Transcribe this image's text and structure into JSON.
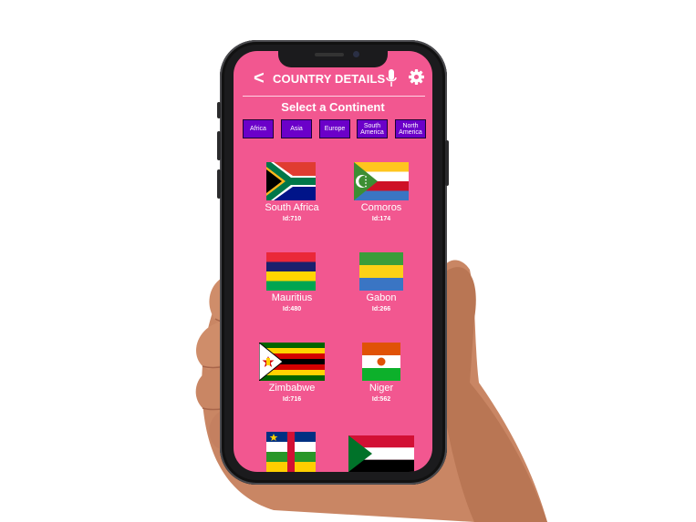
{
  "app": {
    "title": "COUNTRY DETAILS",
    "back_label": "<",
    "subtitle": "Select a Continent"
  },
  "continents": [
    "Africa",
    "Asia",
    "Europe",
    "South America",
    "North America"
  ],
  "countries": [
    {
      "name": "South Africa",
      "id": "Id:710"
    },
    {
      "name": "Comoros",
      "id": "Id:174"
    },
    {
      "name": "Mauritius",
      "id": "Id:480"
    },
    {
      "name": "Gabon",
      "id": "Id:266"
    },
    {
      "name": "Zimbabwe",
      "id": "Id:716"
    },
    {
      "name": "Niger",
      "id": "Id:562"
    }
  ],
  "colors": {
    "screen_bg": "#f25790",
    "chip_bg": "#6b00c9",
    "text": "#ffffff"
  }
}
